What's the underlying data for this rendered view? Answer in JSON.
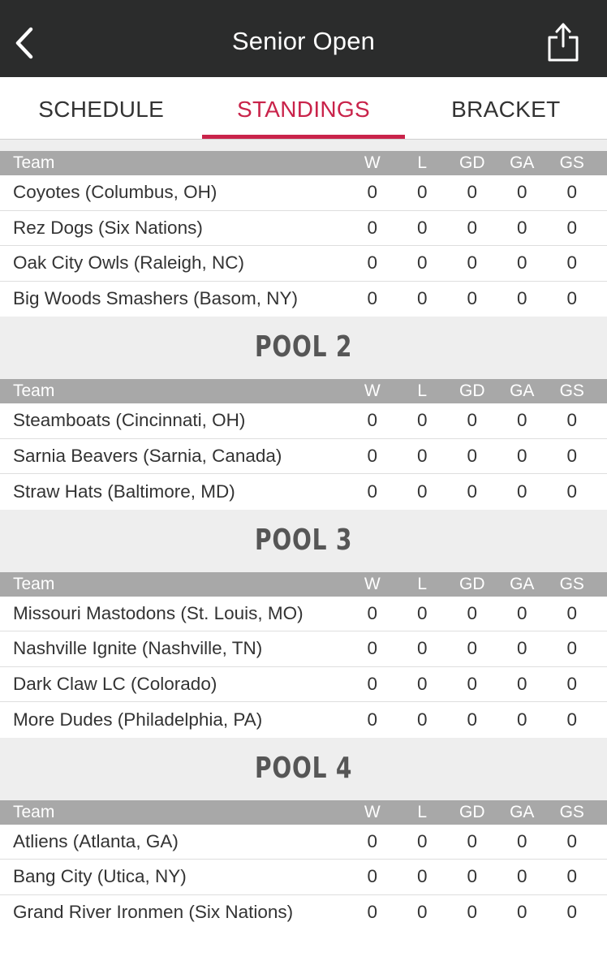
{
  "header": {
    "title": "Senior Open",
    "back_icon": "chevron-left-icon",
    "share_icon": "share-icon",
    "background": "#2b2c2c"
  },
  "tabs": [
    {
      "label": "SCHEDULE",
      "active": false
    },
    {
      "label": "STANDINGS",
      "active": true
    },
    {
      "label": "BRACKET",
      "active": false
    }
  ],
  "accent_color": "#c9234a",
  "table_columns": [
    "Team",
    "W",
    "L",
    "GD",
    "GA",
    "GS"
  ],
  "pools": [
    {
      "title": "",
      "teams": [
        {
          "name": "Coyotes (Columbus, OH)",
          "stats": [
            "0",
            "0",
            "0",
            "0",
            "0"
          ]
        },
        {
          "name": "Rez Dogs (Six Nations)",
          "stats": [
            "0",
            "0",
            "0",
            "0",
            "0"
          ]
        },
        {
          "name": "Oak City Owls (Raleigh, NC)",
          "stats": [
            "0",
            "0",
            "0",
            "0",
            "0"
          ]
        },
        {
          "name": "Big Woods Smashers (Basom, NY)",
          "stats": [
            "0",
            "0",
            "0",
            "0",
            "0"
          ]
        }
      ]
    },
    {
      "title": "POOL 2",
      "teams": [
        {
          "name": "Steamboats (Cincinnati, OH)",
          "stats": [
            "0",
            "0",
            "0",
            "0",
            "0"
          ]
        },
        {
          "name": "Sarnia Beavers (Sarnia, Canada)",
          "stats": [
            "0",
            "0",
            "0",
            "0",
            "0"
          ]
        },
        {
          "name": "Straw Hats (Baltimore, MD)",
          "stats": [
            "0",
            "0",
            "0",
            "0",
            "0"
          ]
        }
      ]
    },
    {
      "title": "POOL 3",
      "teams": [
        {
          "name": "Missouri Mastodons (St. Louis, MO)",
          "stats": [
            "0",
            "0",
            "0",
            "0",
            "0"
          ]
        },
        {
          "name": "Nashville Ignite (Nashville, TN)",
          "stats": [
            "0",
            "0",
            "0",
            "0",
            "0"
          ]
        },
        {
          "name": "Dark Claw LC (Colorado)",
          "stats": [
            "0",
            "0",
            "0",
            "0",
            "0"
          ]
        },
        {
          "name": "More Dudes (Philadelphia, PA)",
          "stats": [
            "0",
            "0",
            "0",
            "0",
            "0"
          ]
        }
      ]
    },
    {
      "title": "POOL 4",
      "teams": [
        {
          "name": "Atliens (Atlanta, GA)",
          "stats": [
            "0",
            "0",
            "0",
            "0",
            "0"
          ]
        },
        {
          "name": "Bang City (Utica, NY)",
          "stats": [
            "0",
            "0",
            "0",
            "0",
            "0"
          ]
        },
        {
          "name": "Grand River Ironmen (Six Nations)",
          "stats": [
            "0",
            "0",
            "0",
            "0",
            "0"
          ]
        }
      ]
    }
  ]
}
